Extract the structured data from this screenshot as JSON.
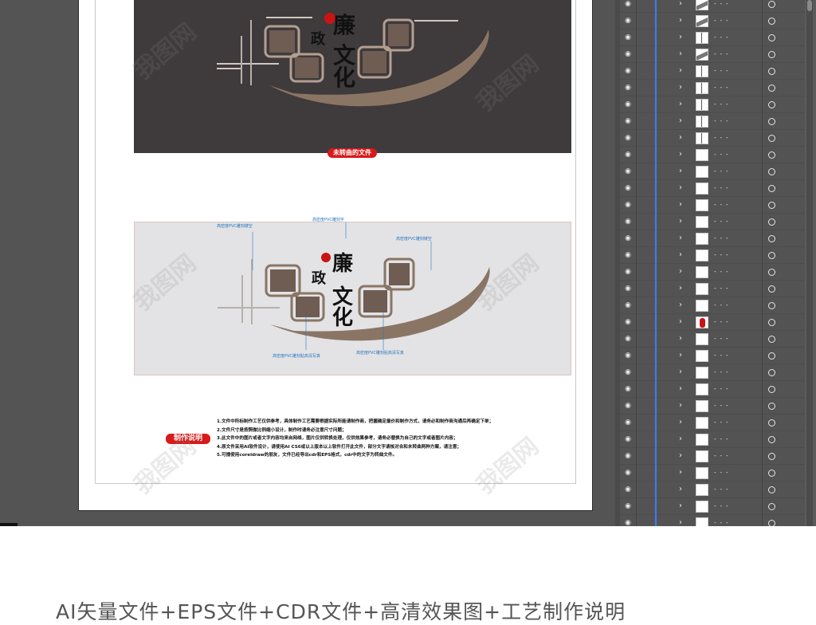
{
  "canvas": {
    "unconverted_label": "未转曲的文件",
    "make_notes_label": "制作说明",
    "title_small_seal": "廉政",
    "title_main": "廉政文化",
    "annotations_top": [
      "高密度PVC雕刻镂空",
      "高密度PVC雕刻字",
      "高密度PVC雕刻镂空"
    ],
    "annotations_bottom": [
      "高密度PVC雕刻贴高清写真",
      "高密度PVC雕刻贴高清写真"
    ],
    "notes": [
      "1.文件中所标制作工艺仅供参考，具体制作工艺需要根据实际所能请制作商，把握确定最价和制作方式，请务必和制作商沟通后再确定下单；",
      "2.文件尺寸是按照做比例缩小设计，制作时请务必注意尺寸问题；",
      "3.此文件中的图片或者文字内容均来自网络，图片仅供转换处理，仅供效果参考，请务必替换为自己的文字或者图片内容；",
      "4.原文件采用AI软件设计，请使用AI CS6或以上版本以上软件打开此文件，部分文字请核对合和未转曲两种方案，请注意；",
      "5.可播使用coreldraw的朋友，文件已经导出cdr和EPS格式，cdr中的文字为转曲文件。"
    ]
  },
  "layers_panel": {
    "rows": [
      {
        "thumb": "swoosh"
      },
      {
        "thumb": "swoosh"
      },
      {
        "thumb": "line"
      },
      {
        "thumb": "swoosh"
      },
      {
        "thumb": "line"
      },
      {
        "thumb": "line"
      },
      {
        "thumb": "line"
      },
      {
        "thumb": "line"
      },
      {
        "thumb": "line"
      },
      {
        "thumb": "blank"
      },
      {
        "thumb": "blank"
      },
      {
        "thumb": "blank"
      },
      {
        "thumb": "blank"
      },
      {
        "thumb": "blank"
      },
      {
        "thumb": "blank"
      },
      {
        "thumb": "blank"
      },
      {
        "thumb": "blank"
      },
      {
        "thumb": "blank"
      },
      {
        "thumb": "blank"
      },
      {
        "thumb": "red"
      },
      {
        "thumb": "blank"
      },
      {
        "thumb": "blank"
      },
      {
        "thumb": "blank"
      },
      {
        "thumb": "blank"
      },
      {
        "thumb": "blank"
      },
      {
        "thumb": "blank"
      },
      {
        "thumb": "blank"
      },
      {
        "thumb": "blank"
      },
      {
        "thumb": "blank"
      },
      {
        "thumb": "blank"
      },
      {
        "thumb": "blank"
      },
      {
        "thumb": "blank"
      }
    ],
    "row_dots": "- - -"
  },
  "caption": "AI矢量文件+EPS文件+CDR文件+高清效果图+工艺制作说明",
  "watermark": "我图网",
  "colors": {
    "workspace": "#545454",
    "dark_design": "#3f3a3b",
    "brown_accent": "#8a7565",
    "red_label": "#d71a1a",
    "annotation_blue": "#2a78c0",
    "layer_blue_bar": "#3a7bff"
  }
}
